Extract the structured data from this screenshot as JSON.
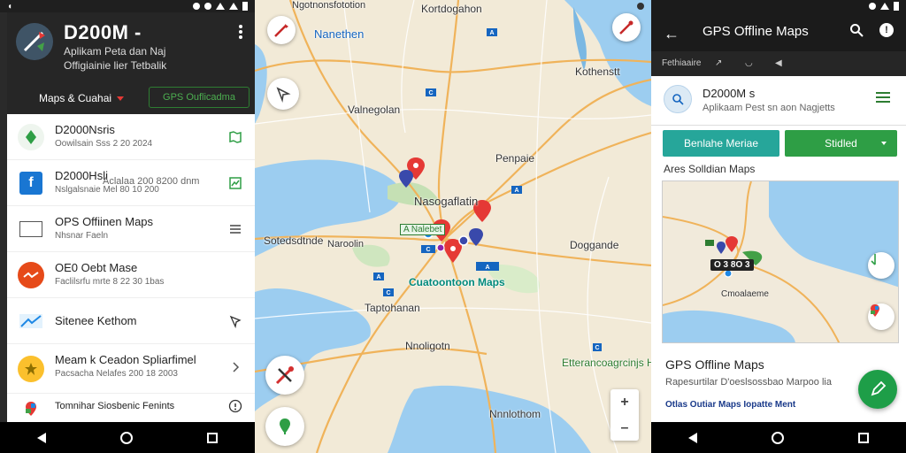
{
  "panel1": {
    "app_title": "D200M -",
    "app_subtitle_1": "Aplikam Peta dan Naj",
    "app_subtitle_2": "Offigiainie lier Tetbalik",
    "dropdown_label": "Maps & Cuahai",
    "gps_button": "GPS Ouflicadma",
    "items": [
      {
        "title": "D2000Nsris",
        "subtitle": "Oowilsain Sss 2 20 2024",
        "icon": "leaf-icon",
        "color": "#2e9e45"
      },
      {
        "title": "D2000Hsli",
        "subtitle": "Nslgalsnaie Mel 80 10 200",
        "extra": "Aclalaa 200 8200 dnm",
        "icon": "facebook-icon",
        "color": "#1976d2"
      },
      {
        "title": "OPS Offiinen Maps",
        "subtitle": "Nhsnar Faeln",
        "icon": "window-icon",
        "color": "#555555"
      },
      {
        "title": "OE0 Oebt Mase",
        "subtitle": "Faclilsrfu mrte 8 22 30 1bas",
        "icon": "wave-icon",
        "color": "#e64a19"
      },
      {
        "title": "Sitenee Kethom",
        "subtitle": "",
        "icon": "chart-icon",
        "color": "#1e88e5"
      },
      {
        "title": "Meam k Ceadon Spliarfimel",
        "subtitle": "Pacsacha Nelafes 200 18 2003",
        "icon": "star-icon",
        "color": "#f9a825"
      },
      {
        "title": "Tomnihar Siosbenic Fenints",
        "subtitle": "",
        "icon": "google-maps-icon",
        "color": "#e53935"
      }
    ]
  },
  "panel2": {
    "labels": {
      "top_center": "Kortdogahon",
      "top_left": "Ngotnonsfototion",
      "city_1": "Nanethen",
      "city_2": "Kothenstt",
      "city_3": "Valnegolan",
      "city_4": "Penpaie",
      "city_5": "Nasogaflatin",
      "city_6": "Sotedsdtnde",
      "city_7": "Naroolin",
      "city_8": "Doggande",
      "city_9": "Cuatoontoon Maps",
      "city_10": "Taptohanan",
      "city_11": "Nnoligotn",
      "city_12": "Etterancoagrcinjs Hae",
      "city_13": "Nnnlothom",
      "green_tag": "A Nalebet",
      "shield_1": "C",
      "shield_2": "A"
    },
    "zoom_in": "+",
    "zoom_out": "–"
  },
  "panel3": {
    "title": "GPS Offline Maps",
    "subbar_label": "Fethiaaire",
    "card_title": "D2000M s",
    "card_subtitle": "Aplikaam Pest sn aon Nagjetts",
    "button_a": "Benlahe Meriae",
    "button_b": "Stidled",
    "section": "Ares Solldian Maps",
    "map_badge": "O 3 8O 3",
    "map_label": "Cmoalaeme",
    "bottom_title": "GPS Offline Maps",
    "bottom_subtitle": "Rapesurtilar D'oeslsossbao Marpoo lia",
    "bottom_link": "Otlas Outiar Maps Iopatte Ment"
  }
}
